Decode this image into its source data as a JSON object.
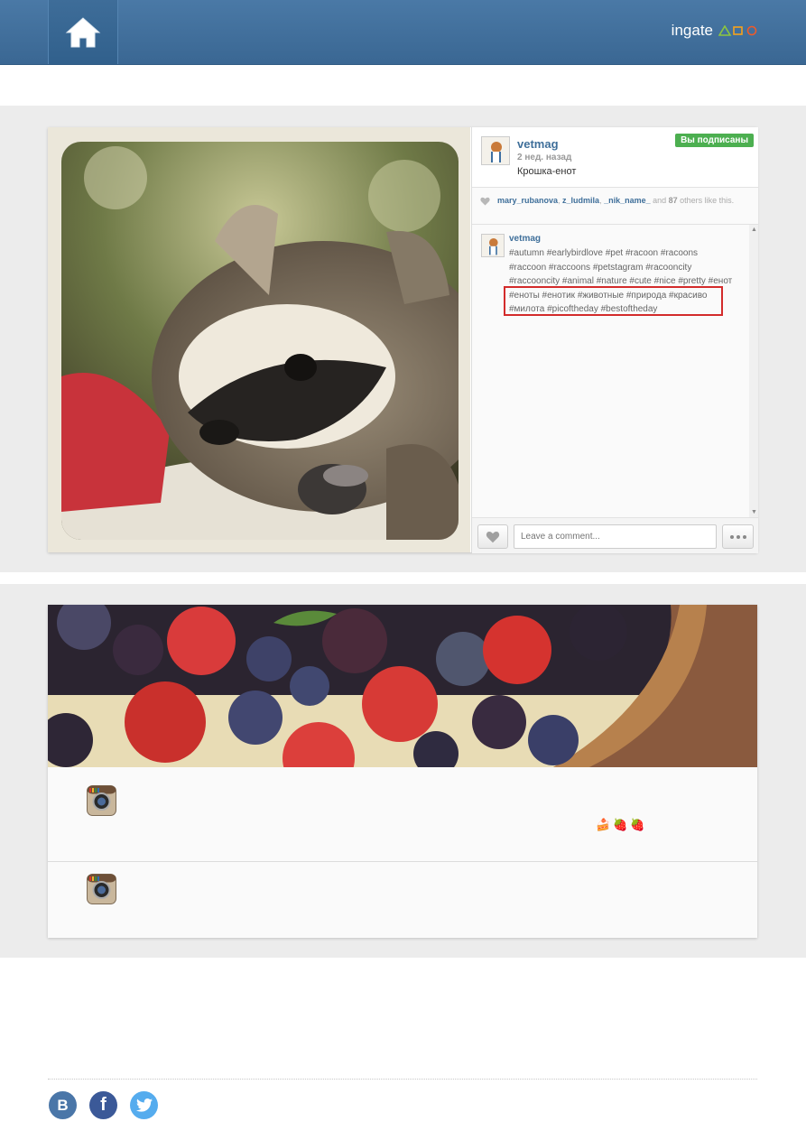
{
  "header": {
    "home_icon": "home-icon",
    "brand_text": "ingate",
    "brand_colors": [
      "#8dc63f",
      "#f7a21b",
      "#f05a28"
    ]
  },
  "post": {
    "username": "vetmag",
    "time_ago": "2 нед. назад",
    "caption": "Крошка-енот",
    "follow_badge": "Вы подписаны",
    "likes": {
      "user1": "mary_rubanova",
      "sep1": ", ",
      "user2": "z_ludmila",
      "sep2": ", ",
      "user3": "_nik_name_",
      "and_text": " and ",
      "count": "87",
      "tail": " others like this."
    },
    "comment": {
      "username": "vetmag",
      "text": "#autumn #earlybirdlove #pet #racoon #racoons #raccoon #raccoons #petstagram #racooncity #raccooncity #animal #nature #cute #nice #pretty #енот #еноты #енотик #животные #природа #красиво #милота #picoftheday #bestoftheday"
    },
    "comment_placeholder": "Leave a comment...",
    "like_icon": "heart-icon",
    "more_icon": "more-dots-icon"
  },
  "feed": {
    "row1_icon": "instagram-icon",
    "row1_emoji": [
      "🍰",
      "🍓",
      "🍓"
    ],
    "row2_icon": "instagram-icon"
  },
  "social": [
    {
      "name": "vk-icon",
      "label": "В",
      "color": "#4a76a8"
    },
    {
      "name": "facebook-icon",
      "label": "f",
      "color": "#3b5998"
    },
    {
      "name": "twitter-icon",
      "label": "t",
      "color": "#55acee"
    }
  ]
}
